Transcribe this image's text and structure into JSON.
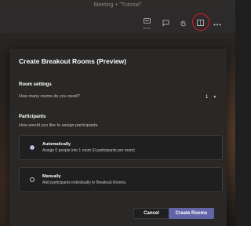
{
  "meeting": {
    "title": "Meeting + \"Tutorial\""
  },
  "toolbar": {
    "buttons": [
      {
        "icon": "show-participants-icon",
        "label": "Show"
      },
      {
        "icon": "chat-icon",
        "label": ""
      },
      {
        "icon": "raise-hand-icon",
        "label": ""
      },
      {
        "icon": "breakout-rooms-icon",
        "label": ""
      },
      {
        "icon": "more-actions-icon",
        "label": ""
      }
    ]
  },
  "dialog": {
    "title": "Create Breakout Rooms (Preview)",
    "room_settings": {
      "heading": "Room settings",
      "question": "How many rooms do you need?",
      "rooms_value": "1"
    },
    "participants": {
      "heading": "Participants",
      "question": "How would you like to assign participants.",
      "options": [
        {
          "title": "Automatically",
          "description": "Assign 0 people into 1 room (0 participants per room)",
          "selected": true
        },
        {
          "title": "Manually",
          "description": "Add participants individually to Breakout Rooms.",
          "selected": false
        }
      ]
    },
    "buttons": {
      "cancel": "Cancel",
      "create": "Create Rooms"
    }
  },
  "colors": {
    "accent": "#6264a7",
    "annotation": "#e01b24",
    "dialog_bg": "#292827"
  }
}
